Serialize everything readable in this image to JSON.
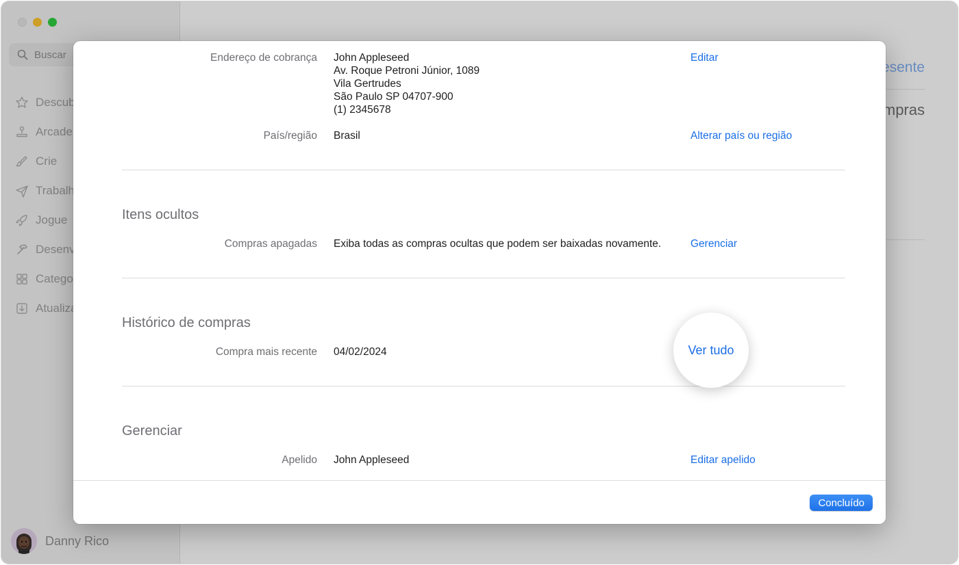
{
  "sidebar": {
    "search_placeholder": "Buscar",
    "items": [
      {
        "label": "Descubra",
        "icon": "star-icon"
      },
      {
        "label": "Arcade",
        "icon": "joystick-icon"
      },
      {
        "label": "Crie",
        "icon": "brush-icon"
      },
      {
        "label": "Trabalhe",
        "icon": "paperplane-icon"
      },
      {
        "label": "Jogue",
        "icon": "rocket-icon"
      },
      {
        "label": "Desenvolva",
        "icon": "hammer-icon"
      },
      {
        "label": "Categorias",
        "icon": "grid-icon"
      },
      {
        "label": "Atualizações",
        "icon": "download-icon"
      }
    ],
    "user_name": "Danny Rico"
  },
  "background": {
    "link_fragment": "esente",
    "title_fragment": "mpras"
  },
  "sheet": {
    "billing": {
      "label": "Endereço de cobrança",
      "lines": [
        "John Appleseed",
        "Av. Roque Petroni Júnior, 1089",
        "Vila Gertrudes",
        "São Paulo SP 04707-900",
        "(1) 2345678"
      ],
      "action": "Editar"
    },
    "country": {
      "label": "País/região",
      "value": "Brasil",
      "action": "Alterar país ou região"
    },
    "hidden_items": {
      "title": "Itens ocultos",
      "label": "Compras apagadas",
      "value": "Exiba todas as compras ocultas que podem ser baixadas novamente.",
      "action": "Gerenciar"
    },
    "purchase_history": {
      "title": "Histórico de compras",
      "label": "Compra mais recente",
      "value": "04/02/2024",
      "action": "Ver tudo"
    },
    "manage": {
      "title": "Gerenciar",
      "label": "Apelido",
      "value": "John Appleseed",
      "action": "Editar apelido"
    },
    "done_label": "Concluído"
  },
  "colors": {
    "accent": "#1a6ee6",
    "button": "#2a7cf0",
    "label_gray": "#6e6e73"
  }
}
